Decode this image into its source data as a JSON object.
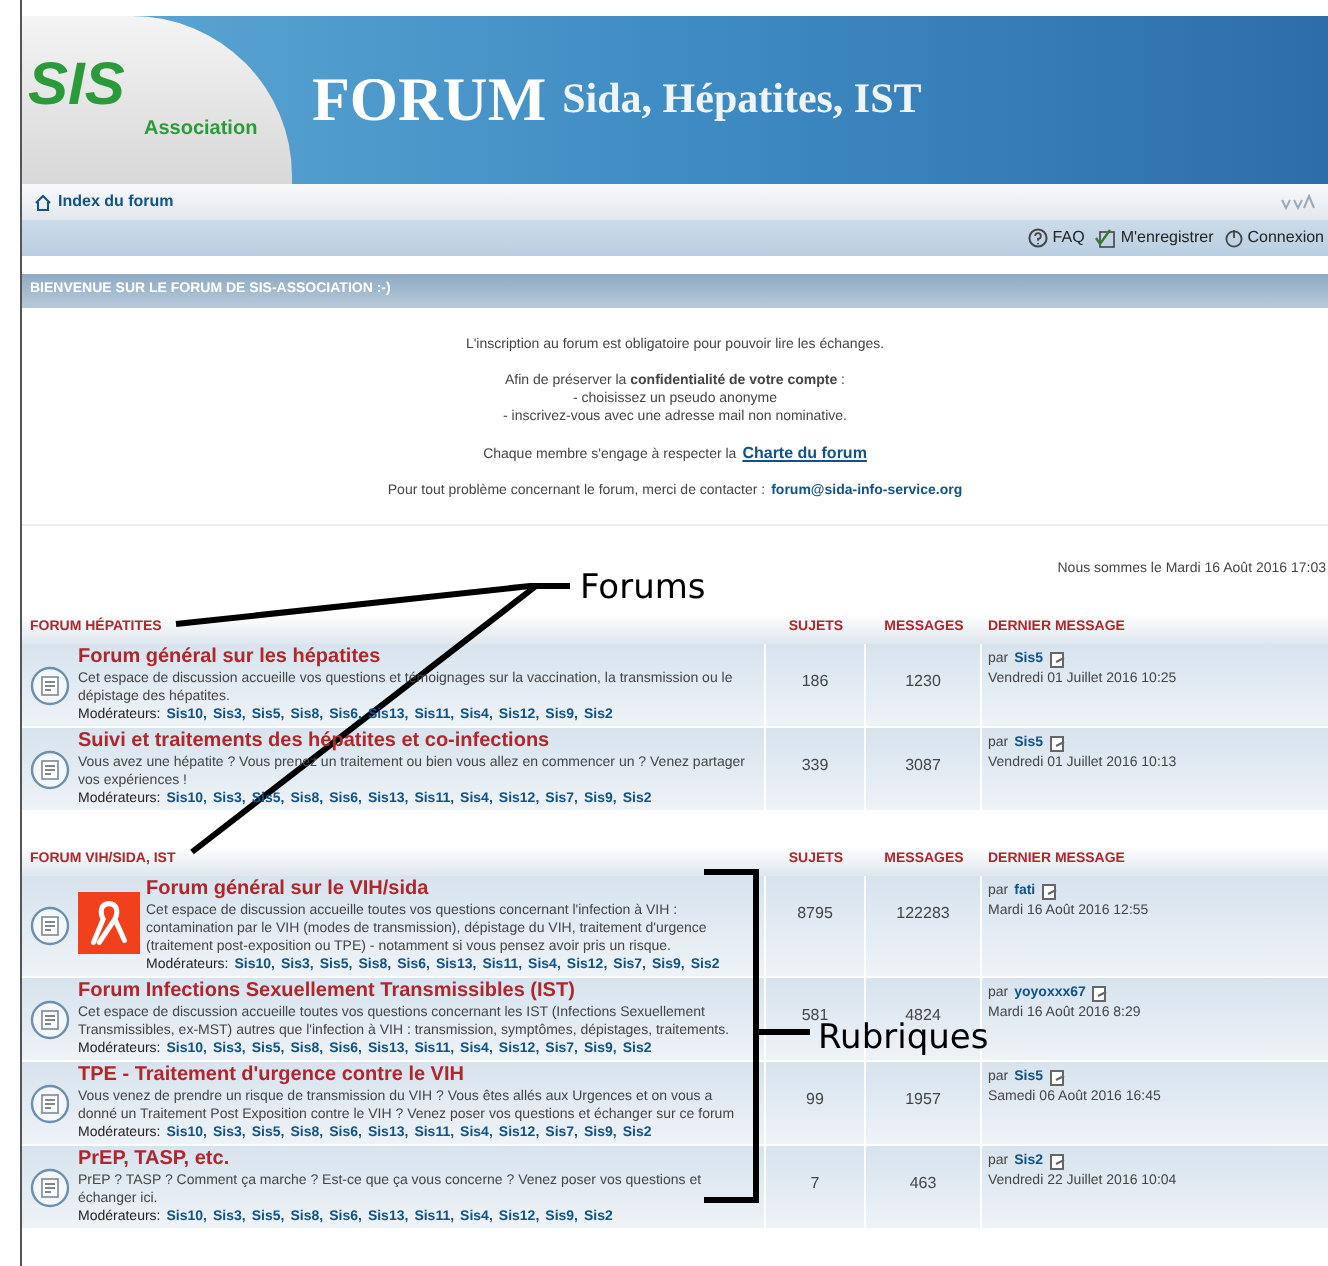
{
  "header": {
    "logo": "SIS",
    "logo_sub": "Association",
    "title": "FORUM",
    "subtitle": "Sida, Hépatites, IST"
  },
  "breadcrumb": "Index du forum",
  "user_links": [
    {
      "kind": "faq",
      "label": "FAQ"
    },
    {
      "kind": "register",
      "label": "M'enregistrer"
    },
    {
      "kind": "login",
      "label": "Connexion"
    }
  ],
  "welcome_title": "BIENVENUE SUR LE FORUM DE SIS-ASSOCIATION :-)",
  "notice": [
    {
      "lines": [
        "L'inscription au forum est obligatoire pour pouvoir lire les échanges."
      ]
    },
    {
      "lines": [
        "Afin de préserver la **confidentialité de votre compte** :",
        "- choisissez un pseudo anonyme",
        "- inscrivez-vous avec une adresse mail non nominative."
      ]
    },
    {
      "lines": [
        "Chaque membre s'engage à respecter la"
      ],
      "link": "Charte du forum",
      "underlined": true
    },
    {
      "lines": [
        "Pour tout problème concernant le forum, merci de contacter :"
      ],
      "link": "forum@sida-info-service.org",
      "underlined": false
    }
  ],
  "date": "Nous sommes le Mardi 16 Août 2016 17:03",
  "categories": [
    {
      "title": "FORUM HÉPATITES",
      "columns": [
        "SUJETS",
        "MESSAGES",
        "DERNIER MESSAGE"
      ],
      "forums": [
        {
          "kind": "plain",
          "title": "Forum général sur les hépatites",
          "description": "Cet espace de discussion accueille vos questions et témoignages sur la vaccination, la transmission ou le dépistage des hépatites.",
          "moderators_label": "Modérateurs:",
          "moderators": [
            "Sis10,",
            "Sis3,",
            "Sis5,",
            "Sis8,",
            "Sis6,",
            "Sis13,",
            "Sis11,",
            "Sis4,",
            "Sis12,",
            "Sis9,",
            "Sis2"
          ],
          "topics": "186",
          "posts": "1230",
          "by_label": "par",
          "last_by": "Sis5",
          "last_date": "Vendredi 01 Juillet 2016 10:25"
        },
        {
          "kind": "plain",
          "title": "Suivi et traitements des hépatites et co-infections",
          "description": "Vous avez une hépatite ? Vous prenez un traitement ou bien vous allez en commencer un ? Venez partager vos expériences !",
          "moderators_label": "Modérateurs:",
          "moderators": [
            "Sis10,",
            "Sis3,",
            "Sis5,",
            "Sis8,",
            "Sis6,",
            "Sis13,",
            "Sis11,",
            "Sis4,",
            "Sis12,",
            "Sis7,",
            "Sis9,",
            "Sis2"
          ],
          "topics": "339",
          "posts": "3087",
          "by_label": "par",
          "last_by": "Sis5",
          "last_date": "Vendredi 01 Juillet 2016 10:13"
        }
      ]
    },
    {
      "title": "FORUM VIH/SIDA, IST",
      "columns": [
        "SUJETS",
        "MESSAGES",
        "DERNIER MESSAGE"
      ],
      "forums": [
        {
          "kind": "ribbon",
          "title": "Forum général sur le VIH/sida",
          "description": "Cet espace de discussion accueille toutes vos questions concernant l'infection à VIH : contamination par le VIH (modes de transmission), dépistage du VIH, traitement d'urgence (traitement post-exposition ou TPE) - notamment si vous pensez avoir pris un risque.",
          "moderators_label": "Modérateurs:",
          "moderators": [
            "Sis10,",
            "Sis3,",
            "Sis5,",
            "Sis8,",
            "Sis6,",
            "Sis13,",
            "Sis11,",
            "Sis4,",
            "Sis12,",
            "Sis7,",
            "Sis9,",
            "Sis2"
          ],
          "topics": "8795",
          "posts": "122283",
          "by_label": "par",
          "last_by": "fati",
          "last_date": "Mardi 16 Août 2016 12:55"
        },
        {
          "kind": "plain",
          "title": "Forum Infections Sexuellement Transmissibles (IST)",
          "description": "Cet espace de discussion accueille toutes vos questions concernant les IST (Infections Sexuellement Transmissibles, ex-MST) autres que l'infection à VIH : transmission, symptômes, dépistages, traitements.",
          "moderators_label": "Modérateurs:",
          "moderators": [
            "Sis10,",
            "Sis3,",
            "Sis5,",
            "Sis8,",
            "Sis6,",
            "Sis13,",
            "Sis11,",
            "Sis4,",
            "Sis12,",
            "Sis7,",
            "Sis9,",
            "Sis2"
          ],
          "topics": "581",
          "posts": "4824",
          "by_label": "par",
          "last_by": "yoyoxxx67",
          "last_date": "Mardi 16 Août 2016 8:29"
        },
        {
          "kind": "plain",
          "title": "TPE - Traitement d'urgence contre le VIH",
          "description": "Vous venez de prendre un risque de transmission du VIH ? Vous êtes allés aux Urgences et on vous a donné un Traitement Post Exposition contre le VIH ? Venez poser vos questions et échanger sur ce forum",
          "moderators_label": "Modérateurs:",
          "moderators": [
            "Sis10,",
            "Sis3,",
            "Sis5,",
            "Sis8,",
            "Sis6,",
            "Sis13,",
            "Sis11,",
            "Sis4,",
            "Sis12,",
            "Sis7,",
            "Sis9,",
            "Sis2"
          ],
          "topics": "99",
          "posts": "1957",
          "by_label": "par",
          "last_by": "Sis5",
          "last_date": "Samedi 06 Août 2016 16:45"
        },
        {
          "kind": "plain",
          "title": "PrEP, TASP, etc.",
          "description": "PrEP ? TASP ? Comment ça marche ? Est-ce que ça vous concerne ? Venez poser vos questions et échanger ici.",
          "moderators_label": "Modérateurs:",
          "moderators": [
            "Sis10,",
            "Sis3,",
            "Sis5,",
            "Sis8,",
            "Sis6,",
            "Sis13,",
            "Sis11,",
            "Sis4,",
            "Sis12,",
            "Sis9,",
            "Sis2"
          ],
          "topics": "7",
          "posts": "463",
          "by_label": "par",
          "last_by": "Sis2",
          "last_date": "Vendredi 22 Juillet 2016 10:04"
        }
      ]
    }
  ],
  "annotations": [
    {
      "text": "Forums"
    },
    {
      "text": "Rubriques"
    }
  ]
}
